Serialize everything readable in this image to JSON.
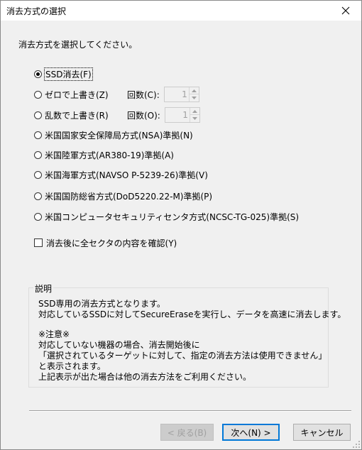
{
  "window": {
    "title": "消去方式の選択"
  },
  "instruction": "消去方式を選択してください。",
  "options": [
    {
      "label": "SSD消去(F)",
      "checked": true
    },
    {
      "label": "ゼロで上書き(Z)",
      "checked": false
    },
    {
      "label": "乱数で上書き(R)",
      "checked": false
    },
    {
      "label": "米国国家安全保障局方式(NSA)準拠(N)",
      "checked": false
    },
    {
      "label": "米国陸軍方式(AR380-19)準拠(A)",
      "checked": false
    },
    {
      "label": "米国海軍方式(NAVSO P-5239-26)準拠(V)",
      "checked": false
    },
    {
      "label": "米国国防総省方式(DoD5220.22-M)準拠(P)",
      "checked": false
    },
    {
      "label": "米国コンピュータセキュリティセンタ方式(NCSC-TG-025)準拠(S)",
      "checked": false
    }
  ],
  "counts": [
    {
      "label": "回数(C):",
      "value": "1"
    },
    {
      "label": "回数(O):",
      "value": "1"
    }
  ],
  "verify_checkbox": {
    "label": "消去後に全セクタの内容を確認(Y)",
    "checked": false
  },
  "description": {
    "title": "説明",
    "lines": [
      "SSD専用の消去方式となります。",
      "対応しているSSDに対してSecureEraseを実行し、データを高速に消去します。",
      "※注意※",
      "対応していない機器の場合、消去開始後に",
      "「選択されているターゲットに対して、指定の消去方法は使用できません」",
      "と表示されます。",
      "上記表示が出た場合は他の消去方法をご利用ください。"
    ]
  },
  "buttons": {
    "back": "< 戻る(B)",
    "next": "次へ(N) >",
    "cancel": "キャンセル"
  },
  "colors": {
    "accent": "#0078d7",
    "background": "#f0f0f0",
    "disabled_text": "#a0a0a0"
  },
  "icons": {
    "close": "close-icon",
    "spin_up": "spin-up-icon",
    "spin_down": "spin-down-icon"
  }
}
